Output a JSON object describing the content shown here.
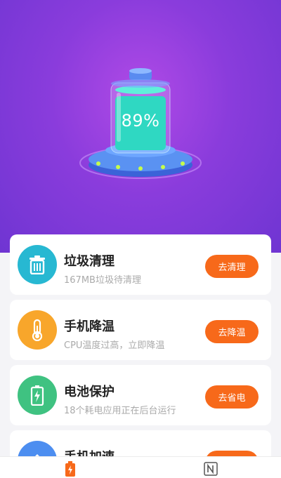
{
  "battery": {
    "percent_text": "89%",
    "level": 0.89
  },
  "colors": {
    "accent": "#f7691a",
    "hero_purple": "#8a3cdc",
    "battery_teal": "#2fd8c2"
  },
  "items": [
    {
      "title": "垃圾清理",
      "subtitle": "167MB垃圾待清理",
      "button": "去清理",
      "icon": "trash-icon",
      "color": "#27b8d2"
    },
    {
      "title": "手机降温",
      "subtitle": "CPU温度过高，立即降温",
      "button": "去降温",
      "icon": "thermometer-icon",
      "color": "#f8a62b"
    },
    {
      "title": "电池保护",
      "subtitle": "18个耗电应用正在后台运行",
      "button": "去省电",
      "icon": "battery-icon",
      "color": "#3fc281"
    },
    {
      "title": "手机加速",
      "subtitle": "",
      "button": "",
      "icon": "rocket-icon",
      "color": "#4d8ef0"
    }
  ],
  "tabs": [
    {
      "name": "battery-tab-icon",
      "active": true
    },
    {
      "name": "news-tab-icon",
      "active": false
    }
  ]
}
